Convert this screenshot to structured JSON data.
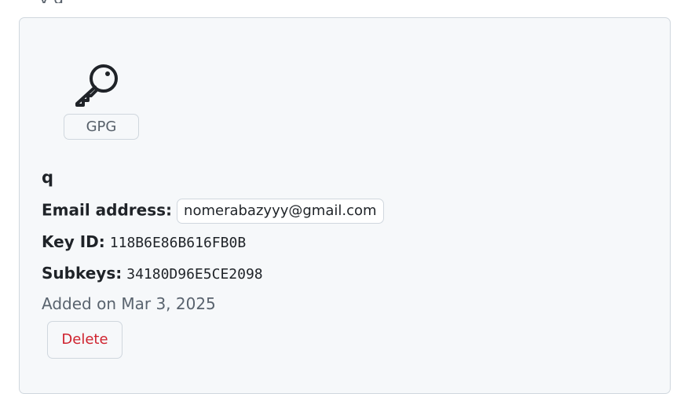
{
  "header": {
    "partial_text": "y                 g"
  },
  "gpg_key": {
    "badge": "GPG",
    "name": "q",
    "email_label": "Email address:",
    "email": "nomerabazyyy@gmail.com",
    "key_id_label": "Key ID:",
    "key_id": "118B6E86B616FB0B",
    "subkeys_label": "Subkeys:",
    "subkeys": "34180D96E5CE2098",
    "added": "Added on Mar 3, 2025",
    "delete_label": "Delete"
  },
  "icons": {
    "key": "key-icon"
  },
  "colors": {
    "danger": "#cf222e",
    "card_bg": "#f6f8fa",
    "border": "#d0d7de"
  }
}
